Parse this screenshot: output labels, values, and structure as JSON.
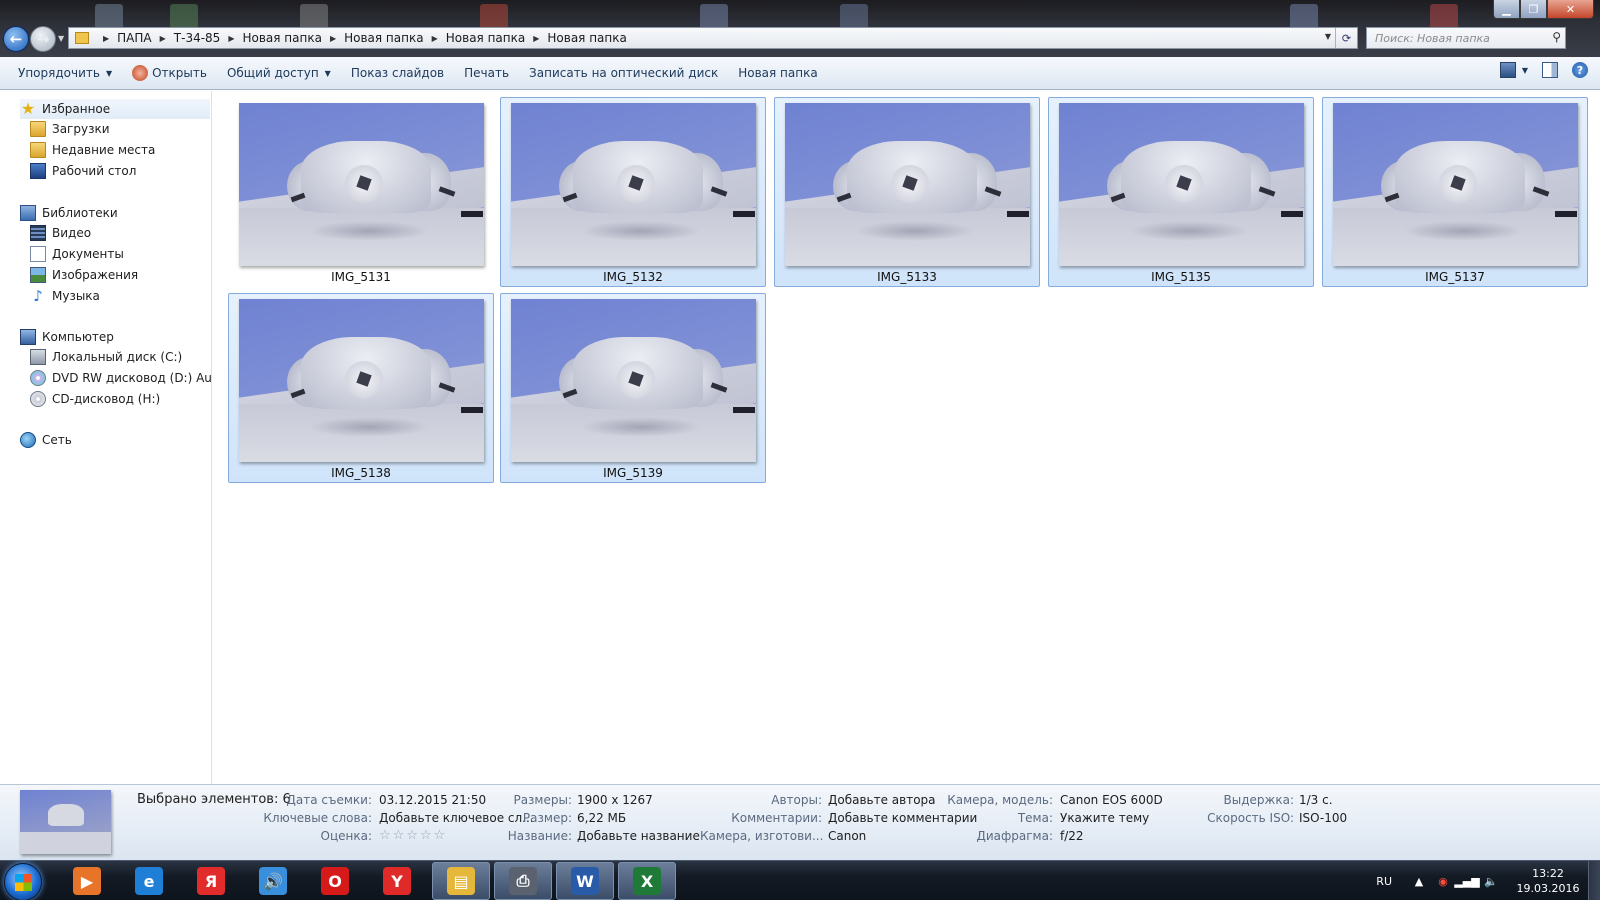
{
  "window": {
    "breadcrumbs": [
      "ПАПА",
      "Т-34-85",
      "Новая папка",
      "Новая папка",
      "Новая папка",
      "Новая папка"
    ],
    "search_placeholder": "Поиск: Новая папка"
  },
  "toolbar": {
    "organize": "Упорядочить",
    "open": "Открыть",
    "share": "Общий доступ",
    "slideshow": "Показ слайдов",
    "print": "Печать",
    "burn": "Записать на оптический диск",
    "new_folder": "Новая папка"
  },
  "sidebar": {
    "favorites": "Избранное",
    "downloads": "Загрузки",
    "recent": "Недавние места",
    "desktop": "Рабочий стол",
    "libraries": "Библиотеки",
    "video": "Видео",
    "documents": "Документы",
    "images": "Изображения",
    "music": "Музыка",
    "computer": "Компьютер",
    "drive_c": "Локальный диск (C:)",
    "drive_d": "DVD RW дисковод (D:) Audio C",
    "drive_h": "CD-дисковод (H:)",
    "network": "Сеть"
  },
  "files": [
    {
      "name": "IMG_5131",
      "selected": false
    },
    {
      "name": "IMG_5132",
      "selected": true
    },
    {
      "name": "IMG_5133",
      "selected": true
    },
    {
      "name": "IMG_5135",
      "selected": true
    },
    {
      "name": "IMG_5137",
      "selected": true
    },
    {
      "name": "IMG_5138",
      "selected": true
    },
    {
      "name": "IMG_5139",
      "selected": true
    }
  ],
  "details": {
    "selected_count": "Выбрано элементов: 6",
    "date_taken_label": "Дата съемки:",
    "date_taken": "03.12.2015 21:50",
    "keywords_label": "Ключевые слова:",
    "keywords": "Добавьте ключевое сл...",
    "rating_label": "Оценка:",
    "rating_stars": "☆☆☆☆☆",
    "dimensions_label": "Размеры:",
    "dimensions": "1900 x 1267",
    "size_label": "Размер:",
    "size": "6,22 МБ",
    "title_label": "Название:",
    "title": "Добавьте название",
    "authors_label": "Авторы:",
    "authors": "Добавьте автора",
    "comments_label": "Комментарии:",
    "comments": "Добавьте комментарии",
    "maker_label": "Камера, изготови...",
    "maker": "Canon",
    "model_label": "Камера, модель:",
    "model": "Canon EOS 600D",
    "subject_label": "Тема:",
    "subject": "Укажите тему",
    "aperture_label": "Диафрагма:",
    "aperture": "f/22",
    "exposure_label": "Выдержка:",
    "exposure": "1/3 с.",
    "iso_label": "Скорость ISO:",
    "iso": "ISO-100"
  },
  "taskbar": {
    "lang": "RU",
    "time": "13:22",
    "date": "19.03.2016",
    "apps": [
      {
        "name": "media-player-icon",
        "glyph": "▶",
        "color": "#e8742a"
      },
      {
        "name": "internet-explorer-icon",
        "glyph": "e",
        "color": "#1f7fd6"
      },
      {
        "name": "yandex-icon",
        "glyph": "Я",
        "color": "#e22c2c"
      },
      {
        "name": "speaker-app-icon",
        "glyph": "🔊",
        "color": "#3a8fdc"
      },
      {
        "name": "opera-icon",
        "glyph": "O",
        "color": "#d61a1a"
      },
      {
        "name": "yandex-browser-icon",
        "glyph": "Y",
        "color": "#e02a2a"
      },
      {
        "name": "explorer-icon",
        "glyph": "▤",
        "color": "#e5b73a"
      },
      {
        "name": "scanner-icon",
        "glyph": "⎙",
        "color": "#5a6270"
      },
      {
        "name": "word-icon",
        "glyph": "W",
        "color": "#2a5ba8"
      },
      {
        "name": "excel-icon",
        "glyph": "X",
        "color": "#1f7a3a"
      }
    ]
  }
}
